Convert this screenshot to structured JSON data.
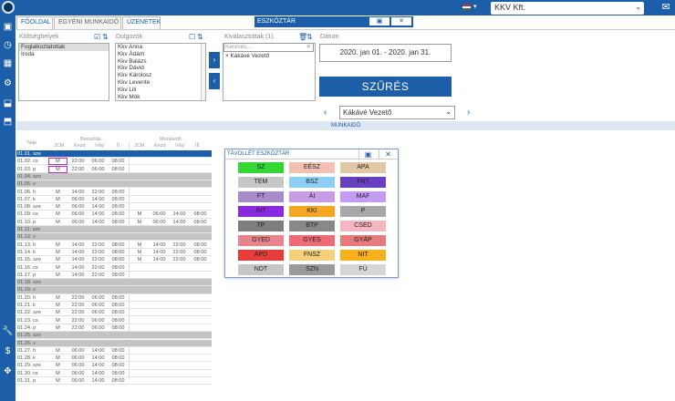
{
  "topbar": {
    "language_flag": "hungarian-flag-icon",
    "company": "KKV Kft."
  },
  "tabs": [
    "FŐOLDAL",
    "EGYÉNI MUNKAIDŐ",
    "ÜZENETEK"
  ],
  "toolbox_title": "ESZKÖZTÁR",
  "panels": {
    "cost_centers": {
      "label": "Költséghelyek",
      "items": [
        "Foglalkoztatottak",
        "Iroda"
      ]
    },
    "employees": {
      "label": "Dolgozók",
      "items": [
        "Kkv Anna",
        "Kkv Ádám",
        "Kkv Balázs",
        "Kkv Dávid",
        "Kkv Károlosz",
        "Kkv Levente",
        "Kkv Lili",
        "Kkv Mók"
      ]
    },
    "selected": {
      "label": "Kiválasztottak (1)",
      "search_placeholder": "Keresés...",
      "items": [
        "Kákávé Vezető"
      ]
    },
    "date": {
      "label": "Dátum",
      "range": "2020. jan 01. - 2020. jan 31."
    }
  },
  "filter_button": "SZŰRÉS",
  "worker_select": "Kákávé Vezető",
  "section_title": "MUNKAIDŐ",
  "grid": {
    "header_groups": [
      "Beosztás",
      "Munkaidő"
    ],
    "columns": [
      "Nap",
      "JCM",
      "Kezd",
      "Vég",
      "ÍÍ",
      "JCM",
      "Kezd",
      "Vég",
      "ÍÍÍ"
    ],
    "rows": [
      {
        "date": "01.01. sze",
        "type": "blue"
      },
      {
        "date": "01.02. cs",
        "type": "w",
        "jcm": "M",
        "kezd": "22:00",
        "veg": "06:00",
        "ii": "08:00",
        "magenta": true
      },
      {
        "date": "01.03. p",
        "type": "w",
        "jcm": "M",
        "kezd": "22:00",
        "veg": "06:00",
        "ii": "08:00",
        "magenta": true
      },
      {
        "date": "01.04. szo",
        "type": "dark"
      },
      {
        "date": "01.05. v",
        "type": "dark"
      },
      {
        "date": "01.06. h",
        "type": "w",
        "jcm": "M",
        "kezd": "14:00",
        "veg": "22:00",
        "ii": "08:00"
      },
      {
        "date": "01.07. k",
        "type": "w",
        "jcm": "M",
        "kezd": "06:00",
        "veg": "14:00",
        "ii": "08:00"
      },
      {
        "date": "01.08. sze",
        "type": "w",
        "jcm": "M",
        "kezd": "06:00",
        "veg": "14:00",
        "ii": "08:00"
      },
      {
        "date": "01.09. cs",
        "type": "w",
        "jcm": "M",
        "kezd": "06:00",
        "veg": "14:00",
        "ii": "08:00",
        "jcm2": "M",
        "kezd2": "06:00",
        "veg2": "14:00",
        "ii2": "08:00"
      },
      {
        "date": "01.10. p",
        "type": "w",
        "jcm": "M",
        "kezd": "06:00",
        "veg": "14:00",
        "ii": "08:00",
        "jcm2": "M",
        "kezd2": "06:00",
        "veg2": "14:00",
        "ii2": "08:00"
      },
      {
        "date": "01.11. szo",
        "type": "dark"
      },
      {
        "date": "01.12. v",
        "type": "dark"
      },
      {
        "date": "01.13. h",
        "type": "w",
        "jcm": "M",
        "kezd": "14:00",
        "veg": "22:00",
        "ii": "08:00",
        "jcm2": "M",
        "kezd2": "14:00",
        "veg2": "22:00",
        "ii2": "08:00"
      },
      {
        "date": "01.14. k",
        "type": "w",
        "jcm": "M",
        "kezd": "14:00",
        "veg": "22:00",
        "ii": "08:00",
        "jcm2": "M",
        "kezd2": "14:00",
        "veg2": "22:00",
        "ii2": "08:00"
      },
      {
        "date": "01.15. sze",
        "type": "w",
        "jcm": "M",
        "kezd": "14:00",
        "veg": "22:00",
        "ii": "08:00",
        "jcm2": "M",
        "kezd2": "14:00",
        "veg2": "22:00",
        "ii2": "08:00"
      },
      {
        "date": "01.16. cs",
        "type": "w",
        "jcm": "M",
        "kezd": "14:00",
        "veg": "22:00",
        "ii": "08:00"
      },
      {
        "date": "01.17. p",
        "type": "w",
        "jcm": "M",
        "kezd": "14:00",
        "veg": "22:00",
        "ii": "08:00"
      },
      {
        "date": "01.18. szo",
        "type": "dark"
      },
      {
        "date": "01.19. v",
        "type": "dark"
      },
      {
        "date": "01.20. h",
        "type": "w",
        "jcm": "M",
        "kezd": "22:00",
        "veg": "06:00",
        "ii": "08:00"
      },
      {
        "date": "01.21. k",
        "type": "w",
        "jcm": "M",
        "kezd": "22:00",
        "veg": "06:00",
        "ii": "08:00"
      },
      {
        "date": "01.22. sze",
        "type": "w",
        "jcm": "M",
        "kezd": "22:00",
        "veg": "06:00",
        "ii": "08:00"
      },
      {
        "date": "01.23. cs",
        "type": "w",
        "jcm": "M",
        "kezd": "22:00",
        "veg": "06:00",
        "ii": "08:00"
      },
      {
        "date": "01.24. p",
        "type": "w",
        "jcm": "M",
        "kezd": "22:00",
        "veg": "06:00",
        "ii": "08:00"
      },
      {
        "date": "01.25. szo",
        "type": "dark"
      },
      {
        "date": "01.26. v",
        "type": "dark"
      },
      {
        "date": "01.27. h",
        "type": "w",
        "jcm": "M",
        "kezd": "06:00",
        "veg": "14:00",
        "ii": "08:00"
      },
      {
        "date": "01.28. k",
        "type": "w",
        "jcm": "M",
        "kezd": "06:00",
        "veg": "14:00",
        "ii": "08:00"
      },
      {
        "date": "01.29. sze",
        "type": "w",
        "jcm": "M",
        "kezd": "06:00",
        "veg": "14:00",
        "ii": "08:00"
      },
      {
        "date": "01.30. cs",
        "type": "w",
        "jcm": "M",
        "kezd": "06:00",
        "veg": "14:00",
        "ii": "08:00"
      },
      {
        "date": "01.31. p",
        "type": "w",
        "jcm": "M",
        "kezd": "06:00",
        "veg": "14:00",
        "ii": "08:00"
      }
    ]
  },
  "absence_toolbox": {
    "title": "TÁVOLLÉT ESZKÖZTÁR",
    "codes": [
      {
        "label": "SZ",
        "color": "#33d633"
      },
      {
        "label": "EÉSZ",
        "color": "#f3c1b3"
      },
      {
        "label": "APA",
        "color": "#e2c9a5"
      },
      {
        "label": "TEM",
        "color": "#c6c6c6"
      },
      {
        "label": "BSZ",
        "color": "#8ed0f5"
      },
      {
        "label": "FNT",
        "color": "#6a3fc2"
      },
      {
        "label": "FT",
        "color": "#a78cc9"
      },
      {
        "label": "ÁI",
        "color": "#c79ee3"
      },
      {
        "label": "MAF",
        "color": "#c49af5"
      },
      {
        "label": "INT",
        "color": "#8a2be2"
      },
      {
        "label": "KKI",
        "color": "#f5a623"
      },
      {
        "label": "P",
        "color": "#a8a8a8"
      },
      {
        "label": "TP",
        "color": "#7e7e7e"
      },
      {
        "label": "BTP",
        "color": "#888888"
      },
      {
        "label": "CSED",
        "color": "#f5b6c1"
      },
      {
        "label": "GYED",
        "color": "#e8848e"
      },
      {
        "label": "GYES",
        "color": "#ef6b75"
      },
      {
        "label": "GYÁP",
        "color": "#e67b7b"
      },
      {
        "label": "APD",
        "color": "#e63c3c"
      },
      {
        "label": "FNSZ",
        "color": "#f5d07a"
      },
      {
        "label": "NIT",
        "color": "#f5b01c"
      },
      {
        "label": "NDT",
        "color": "#c6c6c6"
      },
      {
        "label": "SZN",
        "color": "#9a9a9a"
      },
      {
        "label": "FÜ",
        "color": "#d6d6d6"
      }
    ]
  }
}
